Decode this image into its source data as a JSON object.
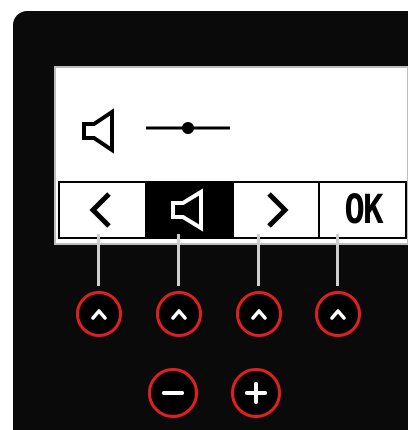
{
  "screen": {
    "setting_icon": "speaker-icon",
    "value_indicator": "slider-icon",
    "softkeys": [
      {
        "label": "<",
        "icon": "chevron-left-icon"
      },
      {
        "label": "",
        "icon": "speaker-icon",
        "active": true
      },
      {
        "label": ">",
        "icon": "chevron-right-icon"
      },
      {
        "label": "OK"
      }
    ]
  },
  "buttons": {
    "softkey_buttons": [
      "chevron-up-icon",
      "chevron-up-icon",
      "chevron-up-icon",
      "chevron-up-icon"
    ],
    "minus": "minus-icon",
    "plus": "plus-icon"
  },
  "colors": {
    "device": "#0a0a0a",
    "button_ring": "#e02020",
    "screen": "#ffffff"
  }
}
